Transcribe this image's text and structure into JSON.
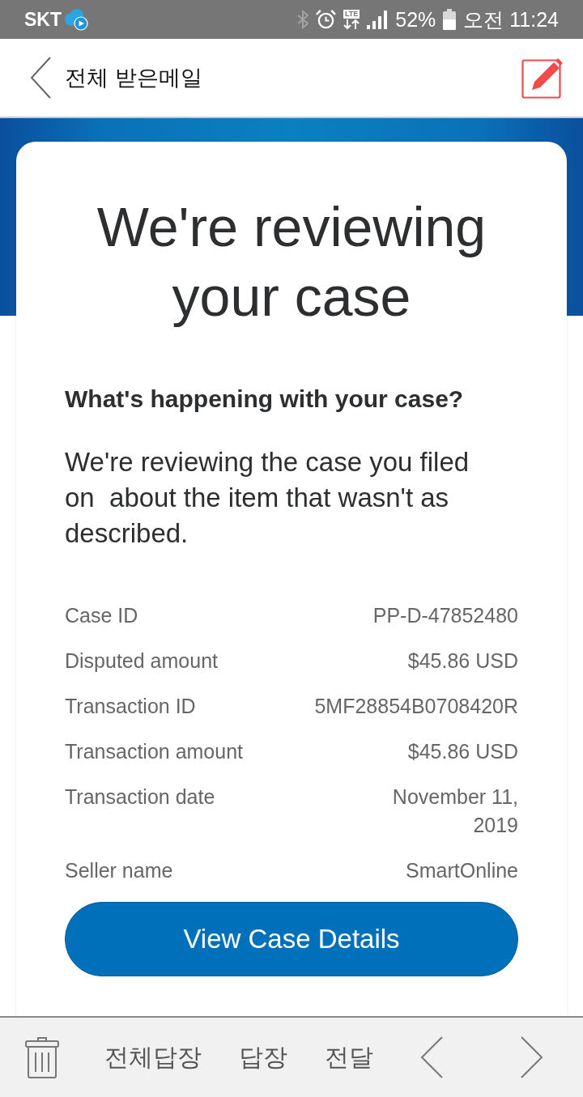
{
  "status_bar": {
    "carrier": "SKT",
    "network": "LTE",
    "battery": "52%",
    "time": "오전 11:24"
  },
  "header": {
    "title": "전체 받은메일"
  },
  "email": {
    "title": "We're reviewing your case",
    "subheading": "What's happening with your case?",
    "message": "We're reviewing the case you filed on  about the item that wasn't as described.",
    "details": [
      {
        "label": "Case ID",
        "value": "PP-D-47852480"
      },
      {
        "label": "Disputed amount",
        "value": "$45.86 USD"
      },
      {
        "label": "Transaction ID",
        "value": "5MF28854B0708420R"
      },
      {
        "label": "Transaction amount",
        "value": "$45.86 USD"
      },
      {
        "label": "Transaction date",
        "value": "November 11, 2019"
      },
      {
        "label": "Seller name",
        "value": "SmartOnline"
      }
    ],
    "button": "View Case Details"
  },
  "toolbar": {
    "actions": [
      "전체답장",
      "답장",
      "전달"
    ]
  }
}
